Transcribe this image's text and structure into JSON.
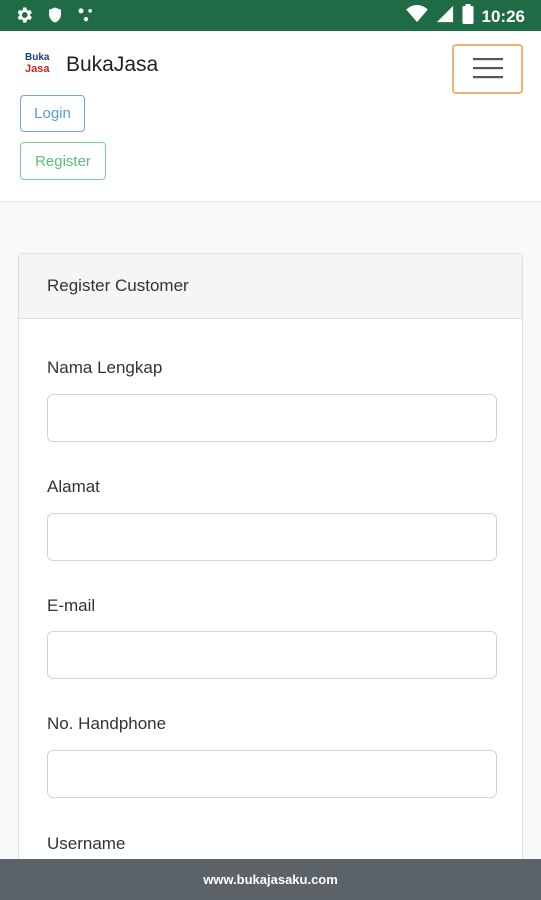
{
  "status_bar": {
    "icons": [
      "gear-icon",
      "shield-icon",
      "network-dots-icon",
      "wifi-icon",
      "signal-icon",
      "battery-icon"
    ],
    "time": "10:26"
  },
  "navbar": {
    "logo_line1": "Buka",
    "logo_line2": "Jasa",
    "brand_name": "BukaJasa",
    "login_label": "Login",
    "register_label": "Register",
    "menu_icon": "hamburger-icon"
  },
  "form": {
    "title": "Register Customer",
    "fields": [
      {
        "label": "Nama Lengkap",
        "value": ""
      },
      {
        "label": "Alamat",
        "value": ""
      },
      {
        "label": "E-mail",
        "value": ""
      },
      {
        "label": "No. Handphone",
        "value": ""
      },
      {
        "label": "Username",
        "value": ""
      }
    ]
  },
  "footer": {
    "text": "www.bukajasaku.com"
  },
  "colors": {
    "status_bar": "#1e6b45",
    "login_border": "#6aa8e6",
    "register_border": "#7fcf94",
    "toggler_border": "#f0b070",
    "footer": "#5b6268"
  }
}
